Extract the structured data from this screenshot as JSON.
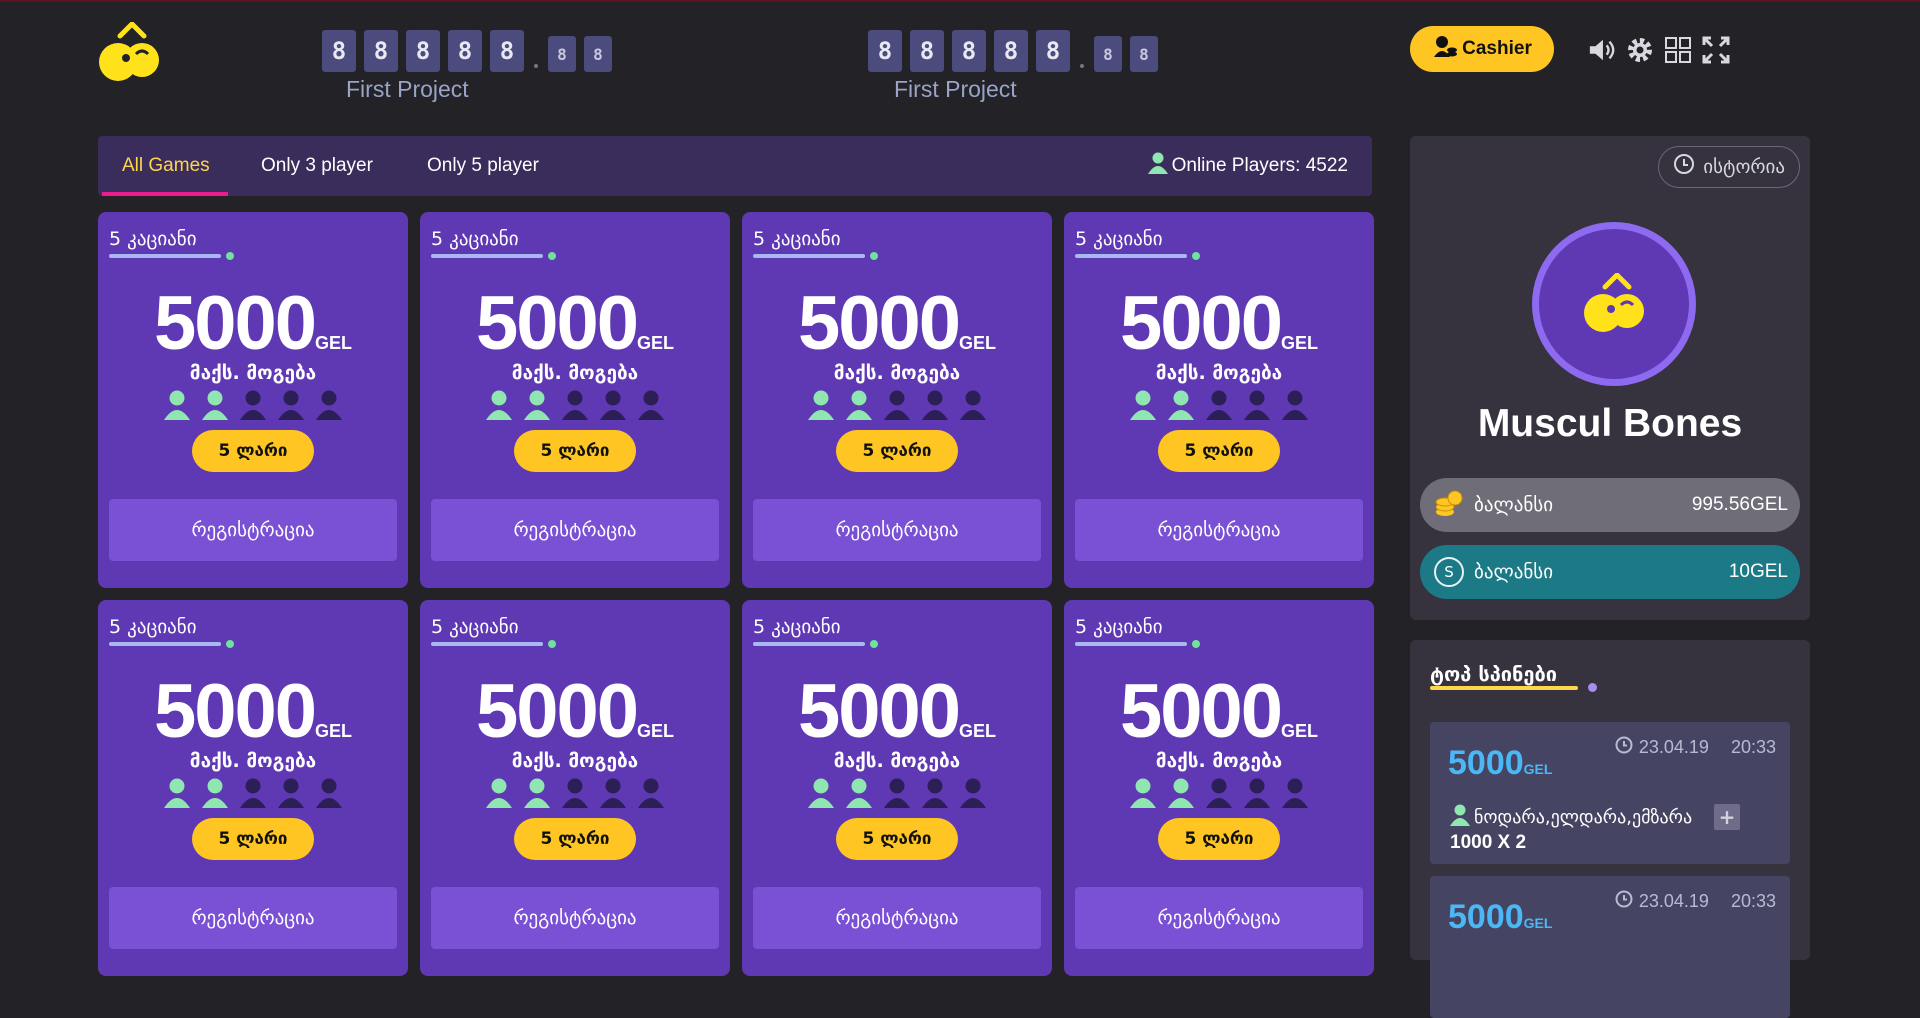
{
  "header": {
    "counters": [
      {
        "big_digits": [
          "8",
          "8",
          "8",
          "8",
          "8"
        ],
        "small_digits": [
          "8",
          "8"
        ],
        "label": "First Project"
      },
      {
        "big_digits": [
          "8",
          "8",
          "8",
          "8",
          "8"
        ],
        "small_digits": [
          "8",
          "8"
        ],
        "label": "First Project"
      }
    ],
    "cashier_label": "Cashier",
    "icons": [
      "volume-icon",
      "settings-icon",
      "grid-icon",
      "fullscreen-icon"
    ]
  },
  "tabs": [
    {
      "label": "All Games",
      "active": true
    },
    {
      "label": "Only 3 player",
      "active": false
    },
    {
      "label": "Only 5 player",
      "active": false
    }
  ],
  "online": {
    "text": "Online Players: 4522"
  },
  "cards": [
    {
      "title": "5 კაციანი",
      "amount": "5000",
      "currency": "GEL",
      "max_label": "მაქს. მოგება",
      "players_joined": 2,
      "players_total": 5,
      "price": "5 ლარი",
      "register": "რეგისტრაცია"
    },
    {
      "title": "5 კაციანი",
      "amount": "5000",
      "currency": "GEL",
      "max_label": "მაქს. მოგება",
      "players_joined": 2,
      "players_total": 5,
      "price": "5 ლარი",
      "register": "რეგისტრაცია"
    },
    {
      "title": "5 კაციანი",
      "amount": "5000",
      "currency": "GEL",
      "max_label": "მაქს. მოგება",
      "players_joined": 2,
      "players_total": 5,
      "price": "5 ლარი",
      "register": "რეგისტრაცია"
    },
    {
      "title": "5 კაციანი",
      "amount": "5000",
      "currency": "GEL",
      "max_label": "მაქს. მოგება",
      "players_joined": 2,
      "players_total": 5,
      "price": "5 ლარი",
      "register": "რეგისტრაცია"
    },
    {
      "title": "5 კაციანი",
      "amount": "5000",
      "currency": "GEL",
      "max_label": "მაქს. მოგება",
      "players_joined": 2,
      "players_total": 5,
      "price": "5 ლარი",
      "register": "რეგისტრაცია"
    },
    {
      "title": "5 კაციანი",
      "amount": "5000",
      "currency": "GEL",
      "max_label": "მაქს. მოგება",
      "players_joined": 2,
      "players_total": 5,
      "price": "5 ლარი",
      "register": "რეგისტრაცია"
    },
    {
      "title": "5 კაციანი",
      "amount": "5000",
      "currency": "GEL",
      "max_label": "მაქს. მოგება",
      "players_joined": 2,
      "players_total": 5,
      "price": "5 ლარი",
      "register": "რეგისტრაცია"
    },
    {
      "title": "5 კაციანი",
      "amount": "5000",
      "currency": "GEL",
      "max_label": "მაქს. მოგება",
      "players_joined": 2,
      "players_total": 5,
      "price": "5 ლარი",
      "register": "რეგისტრაცია"
    }
  ],
  "profile": {
    "history_label": "ისტორია",
    "username": "Muscul Bones",
    "balances": [
      {
        "label": "ბალანსი",
        "value": "995.56GEL",
        "icon": "coins-icon"
      },
      {
        "label": "ბალანსი",
        "value": "10GEL",
        "icon": "s-coin-icon",
        "icon_letter": "S"
      }
    ]
  },
  "top_spins": {
    "title": "ტოპ სპინები",
    "items": [
      {
        "amount": "5000",
        "currency": "GEL",
        "date": "23.04.19",
        "time": "20:33",
        "names": "ნოდარა,ელდარა,ემზარა",
        "multiplier": "1000 X 2"
      },
      {
        "amount": "5000",
        "currency": "GEL",
        "date": "23.04.19",
        "time": "20:33"
      }
    ]
  },
  "colors": {
    "background": "#222227",
    "card": "#5f38b4",
    "accent_yellow": "#ffc623",
    "tab_active_underline": "#e91e8c",
    "player_joined": "#8fe6b0",
    "player_empty": "#2b1f55",
    "balance_teal": "#1b7a86",
    "spin_amount": "#4ab8f5"
  }
}
